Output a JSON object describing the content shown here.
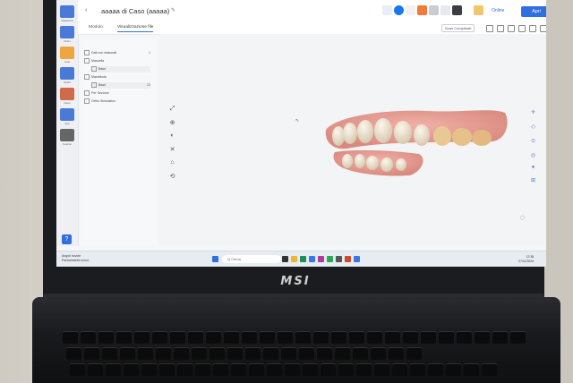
{
  "app": {
    "title": "aaaaa di Caso (aaaaa)",
    "back_glyph": "‹",
    "tabs": [
      "Modulo",
      "Visualizzazione file"
    ],
    "active_tab": 1,
    "scan_button": "Scan Completati",
    "online_label": "Online",
    "open_button": "Apri",
    "accent_color": "#2f6fe0"
  },
  "sidebar": {
    "items": [
      {
        "label": "Statistiche",
        "icon": "chart-icon"
      },
      {
        "label": "Ordini",
        "icon": "flask-icon"
      },
      {
        "label": "Casi",
        "icon": "folder-icon"
      },
      {
        "label": "Ordini",
        "icon": "monitor-icon"
      },
      {
        "label": "Caso",
        "icon": "tooth-icon"
      },
      {
        "label": "App",
        "icon": "grid-icon"
      },
      {
        "label": "Cestino",
        "icon": "trash-icon"
      }
    ]
  },
  "tree": {
    "rows": [
      {
        "label": "Dati non elaborati",
        "right": "1",
        "sub": false
      },
      {
        "label": "Mascella",
        "right": "",
        "sub": false
      },
      {
        "label": "Base",
        "right": "",
        "sub": true
      },
      {
        "label": "Mandibola",
        "right": "",
        "sub": false
      },
      {
        "label": "Base",
        "right": "23",
        "sub": true
      },
      {
        "label": "Per Sezione",
        "right": "",
        "sub": false
      },
      {
        "label": "Ortho Simulation",
        "right": "",
        "sub": false
      }
    ]
  },
  "taskbar": {
    "search_placeholder": "Q Cerca",
    "weather": "Angoli nuvole",
    "weather_sub": "Parzialmente nuvol.",
    "time": "12:38",
    "date": "27/11/2024"
  },
  "hardware": {
    "brand": "MSI"
  }
}
